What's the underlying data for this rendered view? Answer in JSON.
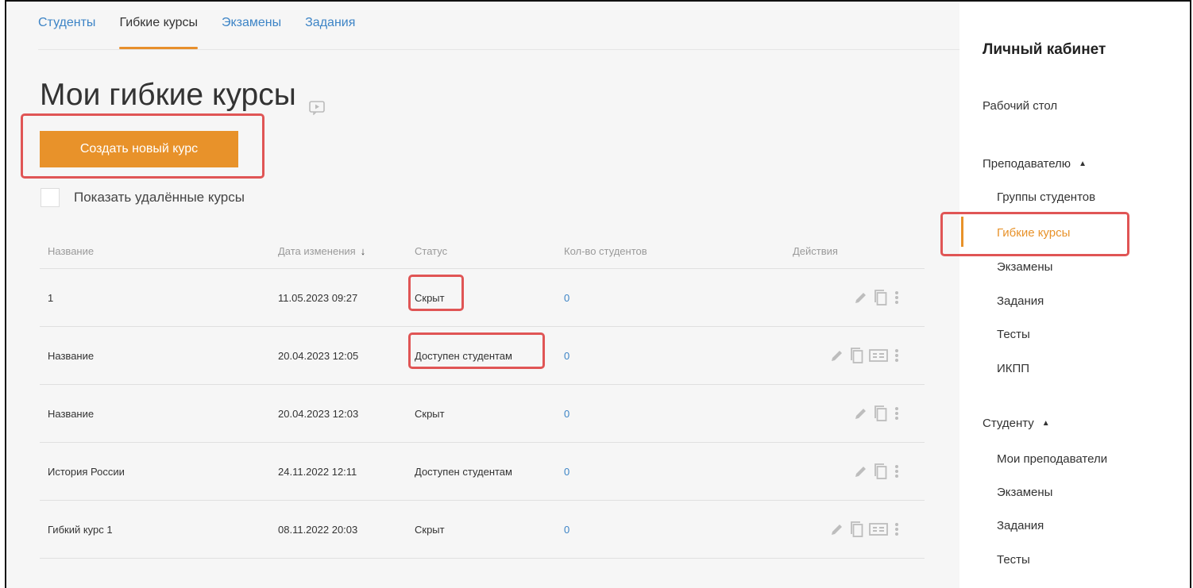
{
  "topnav": {
    "tabs": [
      {
        "label": "Студенты"
      },
      {
        "label": "Гибкие курсы"
      },
      {
        "label": "Экзамены"
      },
      {
        "label": "Задания"
      }
    ]
  },
  "page_title": "Мои гибкие курсы",
  "create_button": "Создать новый курс",
  "show_deleted_label": "Показать удалённые курсы",
  "table": {
    "headers": {
      "name": "Название",
      "date": "Дата изменения",
      "status": "Статус",
      "count": "Кол-во студентов",
      "actions": "Действия"
    },
    "rows": [
      {
        "name": "1",
        "date": "11.05.2023 09:27",
        "status": "Скрыт",
        "count": "0",
        "actions": [
          "edit-icon",
          "copy-icon",
          "more-icon"
        ]
      },
      {
        "name": "Название",
        "date": "20.04.2023 12:05",
        "status": "Доступен студентам",
        "count": "0",
        "actions": [
          "edit-icon",
          "copy-icon",
          "card-icon",
          "more-icon"
        ]
      },
      {
        "name": "Название",
        "date": "20.04.2023 12:03",
        "status": "Скрыт",
        "count": "0",
        "actions": [
          "edit-icon",
          "copy-icon",
          "more-icon"
        ]
      },
      {
        "name": "История России",
        "date": "24.11.2022 12:11",
        "status": "Доступен студентам",
        "count": "0",
        "actions": [
          "edit-icon",
          "copy-icon",
          "more-icon"
        ]
      },
      {
        "name": "Гибкий курс 1",
        "date": "08.11.2022 20:03",
        "status": "Скрыт",
        "count": "0",
        "actions": [
          "edit-icon",
          "copy-icon",
          "card-icon",
          "more-icon"
        ]
      }
    ]
  },
  "sidebar": {
    "title": "Личный кабинет",
    "desktop": "Рабочий стол",
    "teacher_section": "Преподавателю",
    "teacher_items": [
      "Группы студентов",
      "Гибкие курсы",
      "Экзамены",
      "Задания",
      "Тесты",
      "ИКПП"
    ],
    "student_section": "Студенту",
    "student_items": [
      "Мои преподаватели",
      "Экзамены",
      "Задания",
      "Тесты"
    ]
  },
  "colors": {
    "accent": "#e8922a",
    "link": "#3d84c6",
    "highlight": "#e05555"
  }
}
